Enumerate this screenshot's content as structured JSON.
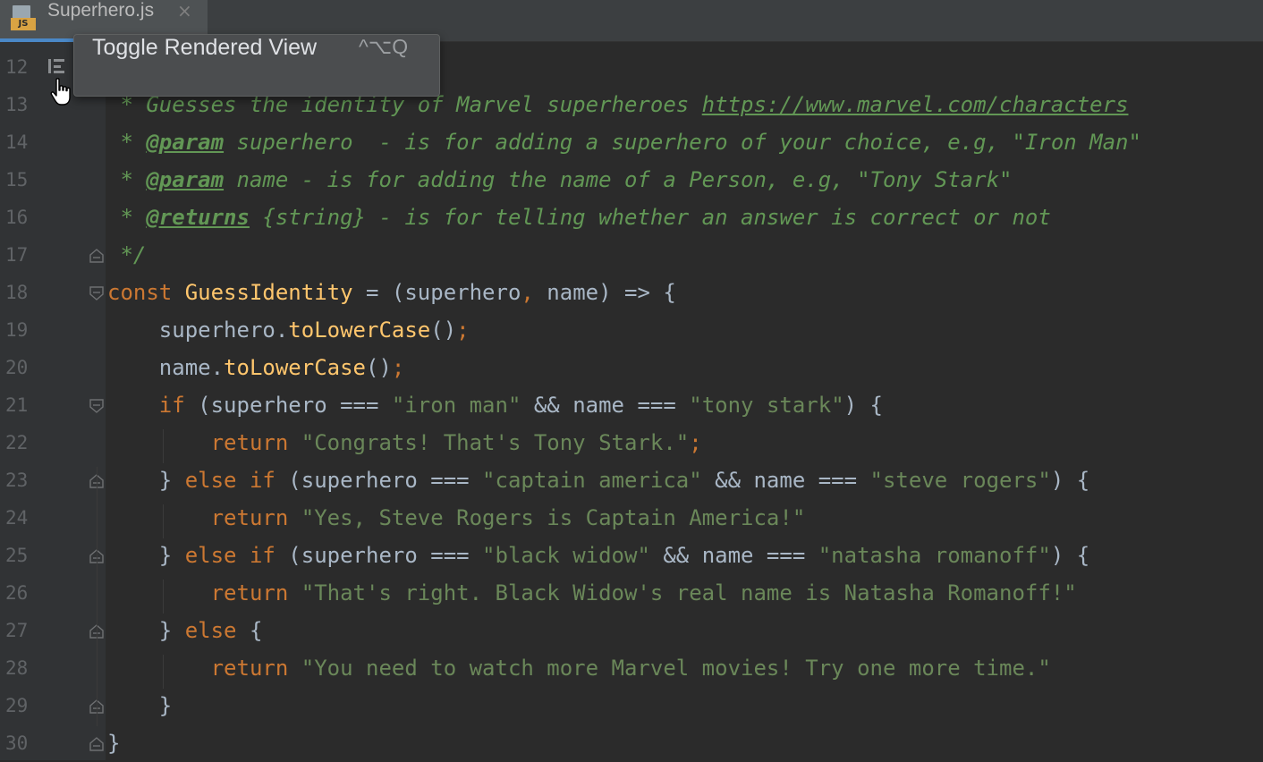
{
  "tab": {
    "title": "Superhero.js",
    "icon_badge": "JS",
    "close_glyph": "×",
    "icon": "javascript-file-icon"
  },
  "tooltip": {
    "label": "Toggle Rendered View",
    "shortcut": "^⌥Q"
  },
  "colors": {
    "background": "#2b2b2b",
    "keyword": "#cc7832",
    "function": "#ffc66d",
    "string": "#6a8759",
    "doc_comment": "#629755",
    "text": "#a9b7c6",
    "accent": "#4a88c7"
  },
  "lines": [
    {
      "num": "12",
      "tokens": []
    },
    {
      "num": "13",
      "tokens": [
        {
          "t": "cm",
          "v": " * Guesses the identity of Marvel superheroes "
        },
        {
          "t": "cm-link",
          "v": "https://www.marvel.com/characters"
        }
      ]
    },
    {
      "num": "14",
      "tokens": [
        {
          "t": "cm",
          "v": " * "
        },
        {
          "t": "cm-tag",
          "v": "@param"
        },
        {
          "t": "cm",
          "v": " superhero  - is for adding a superhero of your choice, e.g, \"Iron Man\""
        }
      ]
    },
    {
      "num": "15",
      "tokens": [
        {
          "t": "cm",
          "v": " * "
        },
        {
          "t": "cm-tag",
          "v": "@param"
        },
        {
          "t": "cm",
          "v": " name - is for adding the name of a Person, e.g, \"Tony Stark\""
        }
      ]
    },
    {
      "num": "16",
      "tokens": [
        {
          "t": "cm",
          "v": " * "
        },
        {
          "t": "cm-tag",
          "v": "@returns"
        },
        {
          "t": "cm",
          "v": " {string} - is for telling whether an answer is correct or not"
        }
      ]
    },
    {
      "num": "17",
      "tokens": [
        {
          "t": "cm",
          "v": " */"
        }
      ]
    },
    {
      "num": "18",
      "tokens": [
        {
          "t": "kw",
          "v": "const "
        },
        {
          "t": "fn",
          "v": "GuessIdentity"
        },
        {
          "t": "plain",
          "v": " = (superhero"
        },
        {
          "t": "punc",
          "v": ", "
        },
        {
          "t": "plain",
          "v": "name) => {"
        }
      ]
    },
    {
      "num": "19",
      "tokens": [
        {
          "t": "plain",
          "v": "    superhero."
        },
        {
          "t": "fn",
          "v": "toLowerCase"
        },
        {
          "t": "plain",
          "v": "()"
        },
        {
          "t": "punc",
          "v": ";"
        }
      ]
    },
    {
      "num": "20",
      "tokens": [
        {
          "t": "plain",
          "v": "    name."
        },
        {
          "t": "fn",
          "v": "toLowerCase"
        },
        {
          "t": "plain",
          "v": "()"
        },
        {
          "t": "punc",
          "v": ";"
        }
      ]
    },
    {
      "num": "21",
      "tokens": [
        {
          "t": "kw",
          "v": "    if "
        },
        {
          "t": "plain",
          "v": "(superhero === "
        },
        {
          "t": "str",
          "v": "\"iron man\""
        },
        {
          "t": "plain",
          "v": " && name === "
        },
        {
          "t": "str",
          "v": "\"tony stark\""
        },
        {
          "t": "plain",
          "v": ") {"
        }
      ]
    },
    {
      "num": "22",
      "tokens": [
        {
          "t": "kw",
          "v": "        return "
        },
        {
          "t": "str",
          "v": "\"Congrats! That's Tony Stark.\""
        },
        {
          "t": "punc",
          "v": ";"
        }
      ]
    },
    {
      "num": "23",
      "tokens": [
        {
          "t": "plain",
          "v": "    } "
        },
        {
          "t": "kw",
          "v": "else if "
        },
        {
          "t": "plain",
          "v": "(superhero === "
        },
        {
          "t": "str",
          "v": "\"captain america\""
        },
        {
          "t": "plain",
          "v": " && name === "
        },
        {
          "t": "str",
          "v": "\"steve rogers\""
        },
        {
          "t": "plain",
          "v": ") {"
        }
      ]
    },
    {
      "num": "24",
      "tokens": [
        {
          "t": "kw",
          "v": "        return "
        },
        {
          "t": "str",
          "v": "\"Yes, Steve Rogers is Captain America!\""
        }
      ]
    },
    {
      "num": "25",
      "tokens": [
        {
          "t": "plain",
          "v": "    } "
        },
        {
          "t": "kw",
          "v": "else if "
        },
        {
          "t": "plain",
          "v": "(superhero === "
        },
        {
          "t": "str",
          "v": "\"black widow\""
        },
        {
          "t": "plain",
          "v": " && name === "
        },
        {
          "t": "str",
          "v": "\"natasha romanoff\""
        },
        {
          "t": "plain",
          "v": ") {"
        }
      ]
    },
    {
      "num": "26",
      "tokens": [
        {
          "t": "kw",
          "v": "        return "
        },
        {
          "t": "str",
          "v": "\"That's right. Black Widow's real name is Natasha Romanoff!\""
        }
      ]
    },
    {
      "num": "27",
      "tokens": [
        {
          "t": "plain",
          "v": "    } "
        },
        {
          "t": "kw",
          "v": "else "
        },
        {
          "t": "plain",
          "v": "{"
        }
      ]
    },
    {
      "num": "28",
      "tokens": [
        {
          "t": "kw",
          "v": "        return "
        },
        {
          "t": "str",
          "v": "\"You need to watch more Marvel movies! Try one more time.\""
        }
      ]
    },
    {
      "num": "29",
      "tokens": [
        {
          "t": "plain",
          "v": "    }"
        }
      ]
    },
    {
      "num": "30",
      "tokens": [
        {
          "t": "plain",
          "v": "}"
        }
      ]
    }
  ],
  "fold_markers": {
    "17": "fold-end-icon",
    "18": "fold-start-icon",
    "21": "fold-start-icon",
    "23": "fold-end-icon",
    "25": "fold-end-icon",
    "27": "fold-end-icon",
    "29": "fold-end-icon",
    "30": "fold-end-icon"
  }
}
